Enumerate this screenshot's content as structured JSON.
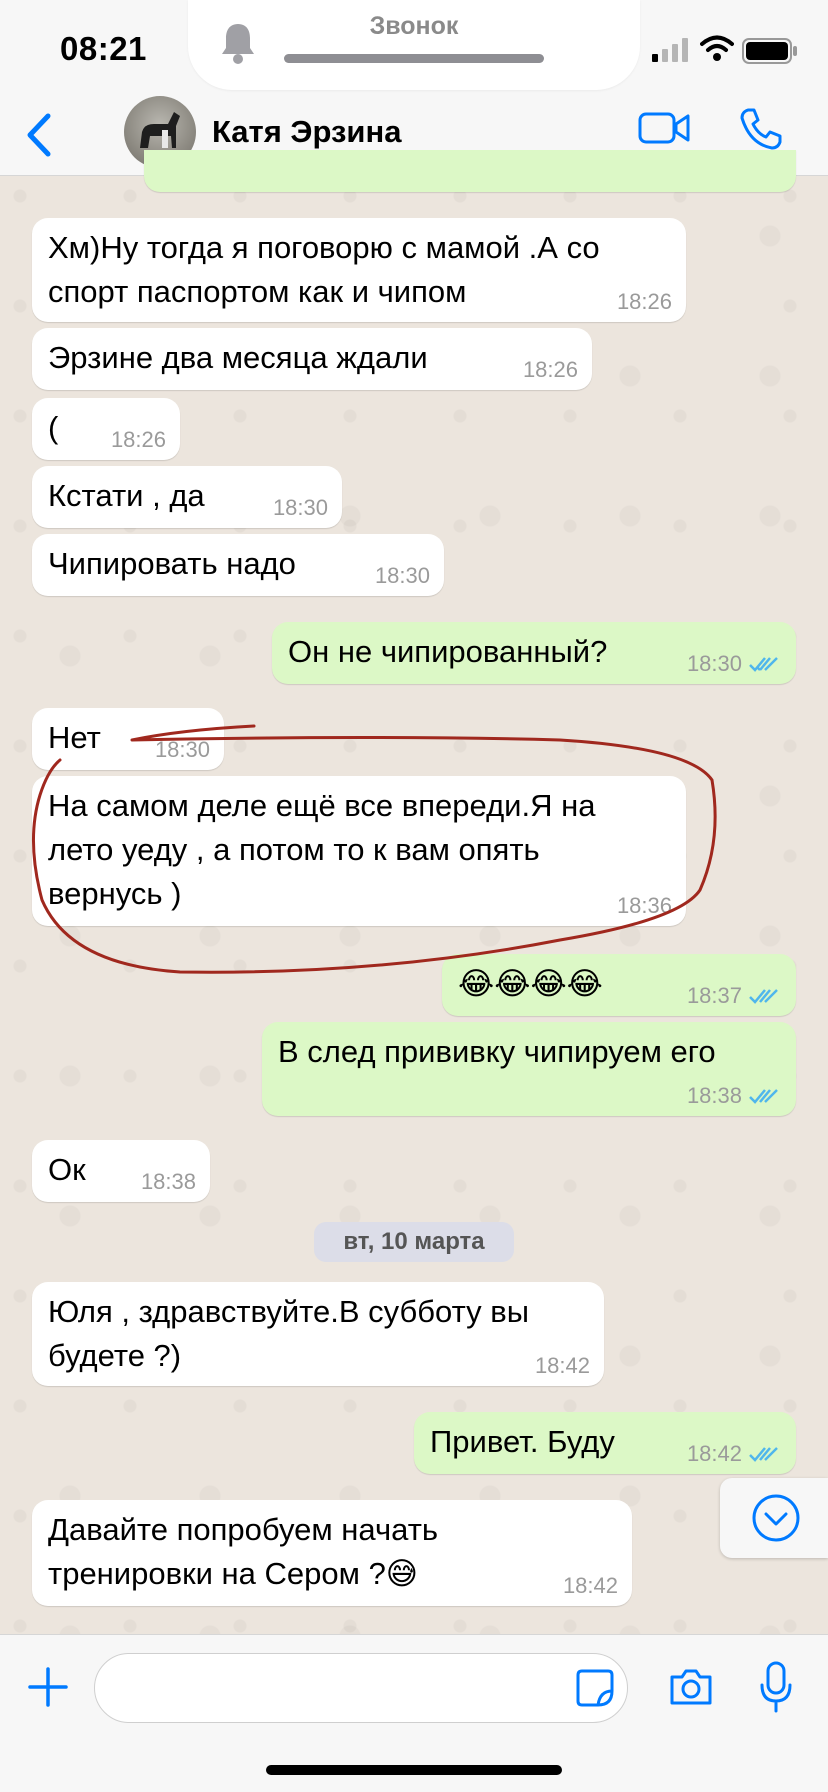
{
  "status_bar": {
    "time": "08:21",
    "call_label": "Звонок"
  },
  "header": {
    "contact_name": "Катя Эрзина"
  },
  "messages": [
    {
      "dir": "in",
      "text": "Хм)Ну тогда я поговорю с мамой .А со\nспорт паспортом как и чипом",
      "time": "18:26"
    },
    {
      "dir": "in",
      "text": "Эрзине два месяца ждали",
      "time": "18:26"
    },
    {
      "dir": "in",
      "text": "(",
      "time": "18:26"
    },
    {
      "dir": "in",
      "text": "Кстати , да",
      "time": "18:30"
    },
    {
      "dir": "in",
      "text": "Чипировать надо",
      "time": "18:30"
    },
    {
      "dir": "out",
      "text": "Он не чипированный?",
      "time": "18:30"
    },
    {
      "dir": "in",
      "text": "Нет",
      "time": "18:30"
    },
    {
      "dir": "in",
      "text": "На самом деле ещё все впереди.Я на\nлето уеду , а потом то к вам опять\nвернусь )",
      "time": "18:36"
    },
    {
      "dir": "out",
      "text": "😂😂😂😂",
      "time": "18:37"
    },
    {
      "dir": "out",
      "text": "В след прививку чипируем его",
      "time": "18:38"
    },
    {
      "dir": "in",
      "text": "Ок",
      "time": "18:38"
    },
    {
      "dir": "in",
      "text": "Юля , здравствуйте.В субботу вы\nбудете ?)",
      "time": "18:42"
    },
    {
      "dir": "out",
      "text": "Привет. Буду",
      "time": "18:42"
    },
    {
      "dir": "in",
      "text": "Давайте попробуем начать\nтренировки на Сером ?😅",
      "time": "18:42"
    }
  ],
  "date_divider": "вт, 10 марта",
  "input": {
    "value": "",
    "placeholder": ""
  },
  "colors": {
    "accent": "#007aff",
    "incoming": "#ffffff",
    "outgoing": "#dcf8c6",
    "read_ticks": "#4fb6ec",
    "annotation": "#a0281e"
  }
}
